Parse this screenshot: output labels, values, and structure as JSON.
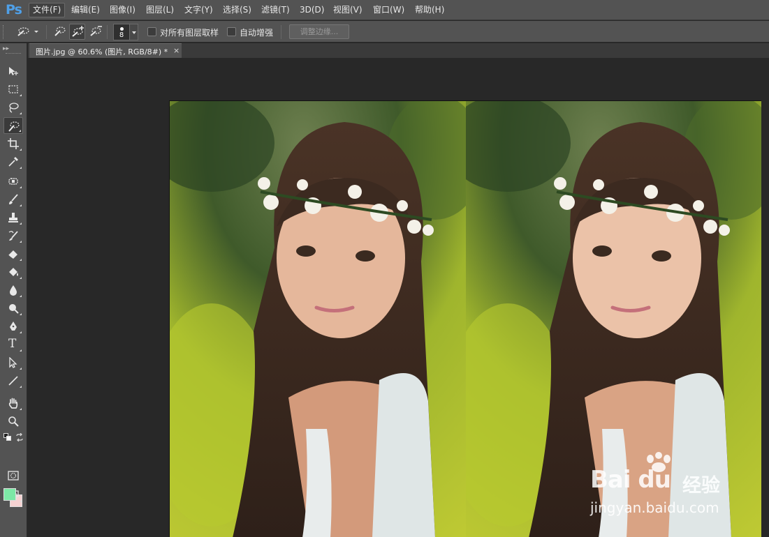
{
  "app": {
    "logo": "Ps"
  },
  "menu": [
    {
      "label": "文件(F)",
      "active": true
    },
    {
      "label": "编辑(E)"
    },
    {
      "label": "图像(I)"
    },
    {
      "label": "图层(L)"
    },
    {
      "label": "文字(Y)"
    },
    {
      "label": "选择(S)"
    },
    {
      "label": "滤镜(T)"
    },
    {
      "label": "3D(D)"
    },
    {
      "label": "视图(V)"
    },
    {
      "label": "窗口(W)"
    },
    {
      "label": "帮助(H)"
    }
  ],
  "options": {
    "brush_size": "8",
    "sample_all_layers_label": "对所有图层取样",
    "sample_all_layers_checked": false,
    "auto_enhance_label": "自动增强",
    "auto_enhance_checked": false,
    "refine_edge_label": "调整边缘..."
  },
  "toolbox": {
    "header": "▸▸",
    "tools": [
      {
        "name": "move-tool-icon"
      },
      {
        "name": "marquee-tool-icon"
      },
      {
        "name": "lasso-tool-icon"
      },
      {
        "name": "quick-selection-tool-icon",
        "selected": true
      },
      {
        "name": "crop-tool-icon"
      },
      {
        "name": "eyedropper-tool-icon"
      },
      {
        "name": "healing-brush-tool-icon"
      },
      {
        "name": "brush-tool-icon"
      },
      {
        "name": "clone-stamp-tool-icon"
      },
      {
        "name": "history-brush-tool-icon"
      },
      {
        "name": "eraser-tool-icon"
      },
      {
        "name": "paint-bucket-tool-icon"
      },
      {
        "name": "blur-tool-icon"
      },
      {
        "name": "dodge-tool-icon"
      },
      {
        "name": "pen-tool-icon"
      },
      {
        "name": "type-tool-icon"
      },
      {
        "name": "path-selection-tool-icon"
      },
      {
        "name": "line-tool-icon"
      },
      {
        "name": "hand-tool-icon"
      },
      {
        "name": "zoom-tool-icon"
      }
    ],
    "type_tool_glyph": "T",
    "foreground_color": "#7de8a6",
    "background_color": "#f6d2d2"
  },
  "document": {
    "tab_title": "图片.jpg @ 60.6% (图片, RGB/8#) *",
    "close_glyph": "×"
  },
  "watermark": {
    "logo_text": "Bai du",
    "cn_text": "经验",
    "url": "jingyan.baidu.com"
  }
}
